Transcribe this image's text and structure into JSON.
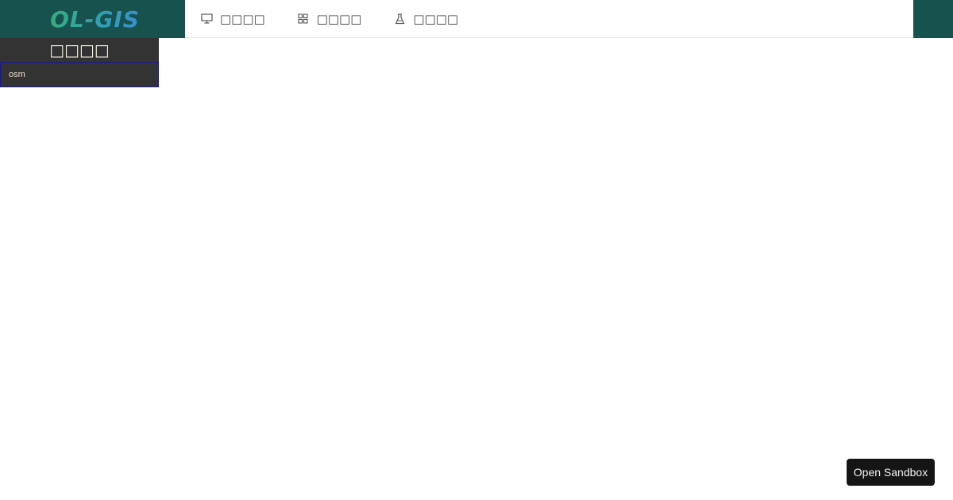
{
  "app": {
    "logo_text": "OL-GIS"
  },
  "nav": {
    "items": [
      {
        "icon": "monitor-icon",
        "label": "□□□□"
      },
      {
        "icon": "grid-icon",
        "label": "□□□□"
      },
      {
        "icon": "flask-icon",
        "label": "□□□□"
      }
    ]
  },
  "sidebar": {
    "title": "□□□□",
    "layers": [
      {
        "label": "osm"
      }
    ]
  },
  "sandbox": {
    "button_label": "Open Sandbox"
  },
  "colors": {
    "header_bg": "#17524f",
    "sidebar_bg": "#333333",
    "selected_border": "#1a1a8c",
    "logo_gradient_start": "#35ad7c",
    "logo_gradient_end": "#3a8fcf"
  }
}
